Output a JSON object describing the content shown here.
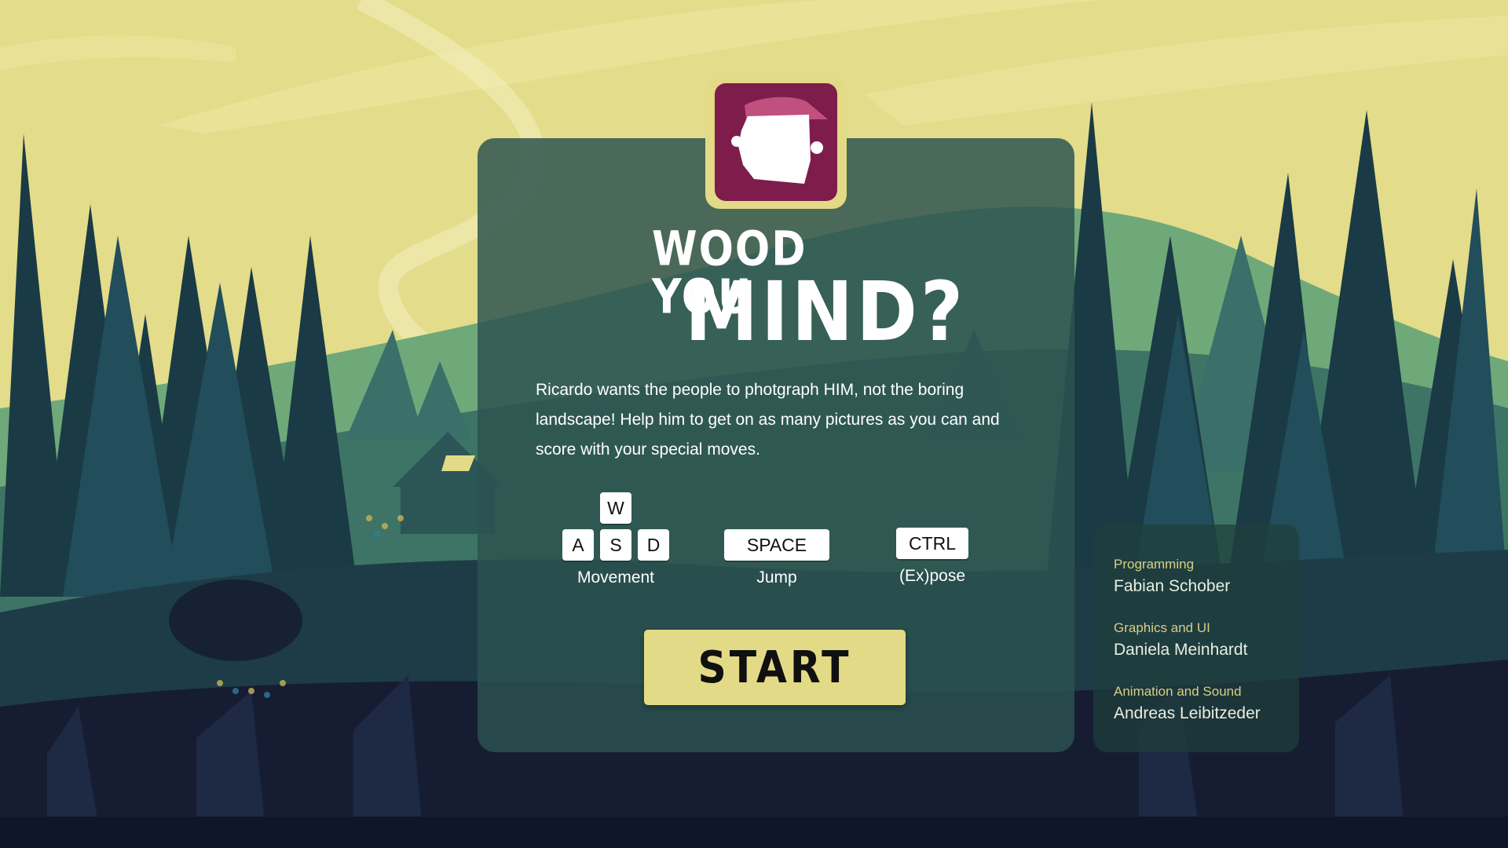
{
  "game": {
    "title_line1": "WOOD YOU",
    "title_line2": "MIND?",
    "description": "Ricardo wants the people to photgraph HIM, not the boring landscape! Help him to get on as many pictures as you can and score with your special moves.",
    "start_label": "START"
  },
  "controls": {
    "movement": {
      "keys": [
        "W",
        "A",
        "S",
        "D"
      ],
      "label": "Movement"
    },
    "jump": {
      "key": "SPACE",
      "label": "Jump"
    },
    "expose": {
      "key": "CTRL",
      "label": "(Ex)pose"
    }
  },
  "credits": [
    {
      "role": "Programming",
      "name": "Fabian Schober"
    },
    {
      "role": "Graphics and UI",
      "name": "Daniela Meinhardt"
    },
    {
      "role": "Animation and Sound",
      "name": "Andreas Leibitzeder"
    }
  ],
  "colors": {
    "sky": "#e2da86",
    "accent_yellow": "#e2da86",
    "logo_bg": "#7e1d4b",
    "card_bg": "#2c5250"
  },
  "icons": {
    "logo": "ricardo-face-icon"
  }
}
